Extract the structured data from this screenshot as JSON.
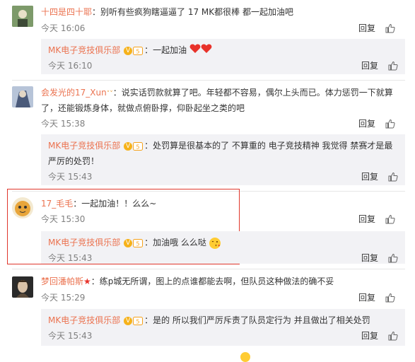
{
  "colors": {
    "username": "#eb7350",
    "meta": "#808080",
    "reply_bg": "#f2f2f5",
    "highlight": "#e0362b",
    "v_badge": "#f6b21a"
  },
  "labels": {
    "reply": "回复",
    "like_icon": "thumbs-up-icon",
    "today": "今天"
  },
  "comments": [
    {
      "user": "十四是四十耶",
      "text": "：别听有些疯狗瞎逼逼了 17 MK都很棒  都一起加油吧",
      "text2": "",
      "time": "今天 16:06",
      "likes": "",
      "reply": {
        "user": "MK电子竞技俱乐部",
        "text": "：一起加油",
        "text2": "",
        "time": "今天 16:10",
        "emoji": "two-hearts"
      }
    },
    {
      "user": "会发光的17_Xun",
      "user_suffix": "˅˅",
      "text": "：说实话罚款就算了吧。年轻都不容易，偶尔上头而已。体力惩罚一下就算",
      "text2": "了，还能锻炼身体，就做点俯卧撑，仰卧起坐之类的吧",
      "time": "今天 15:38",
      "likes": "",
      "reply": {
        "user": "MK电子竞技俱乐部",
        "text": "：处罚算是很基本的了 不算重的 电子竞技精神 我觉得 禁赛才是最",
        "text2": "严厉的处罚！",
        "time": "今天 15:43"
      }
    },
    {
      "user": "17_毛毛",
      "text": "：一起加油！！么么~",
      "text2": "",
      "time": "今天 15:30",
      "likes": "",
      "reply": {
        "user": "MK电子竞技俱乐部",
        "text": "：加油哦 么么哒",
        "text2": "",
        "time": "今天 15:43",
        "emoji": "kiss-face"
      }
    },
    {
      "user": "梦回潘帕斯",
      "text": "：练p城无所谓，图上的点谁都能去啊，但队员这种做法的确不妥",
      "text2": "",
      "time": "今天 15:29",
      "likes": "",
      "reply": {
        "user": "MK电子竞技俱乐部",
        "text": "：是的 所以我们严厉斥责了队员定行为 并且做出了相关处罚",
        "text2": "",
        "time": "今天 15:43"
      }
    }
  ]
}
